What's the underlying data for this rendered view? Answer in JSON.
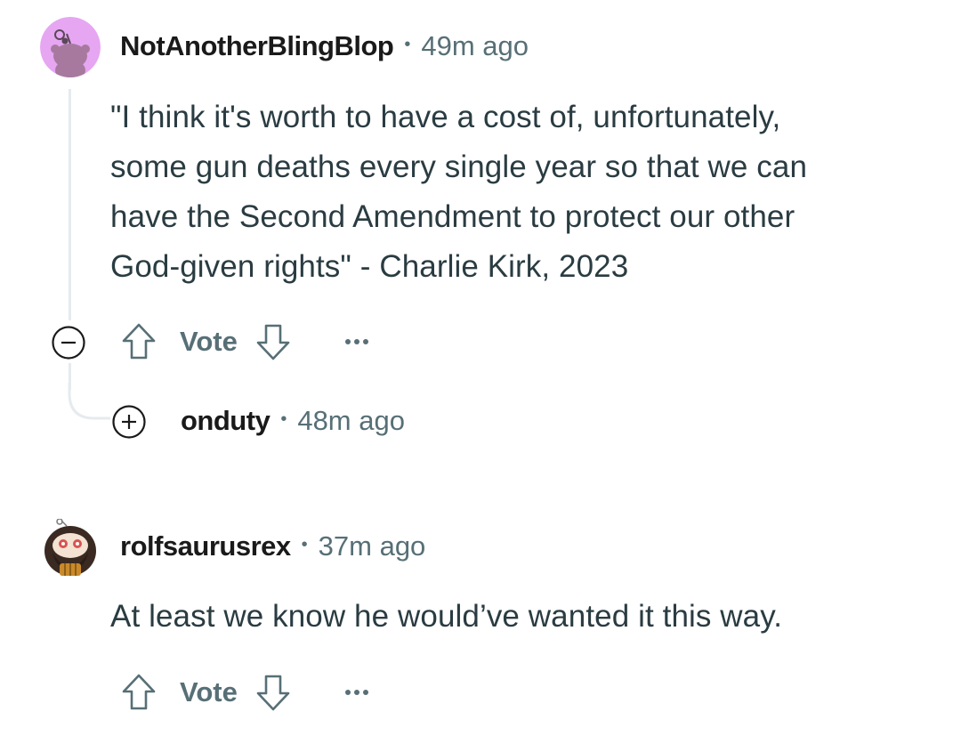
{
  "comments": [
    {
      "username": "NotAnotherBlingBlop",
      "separator": "•",
      "time": "49m ago",
      "lines": [
        "\"I think it's worth to have a cost of, unfortunately,",
        "some gun deaths every single year so that we can",
        "have the Second Amendment to protect our other",
        "God-given rights\" - Charlie Kirk, 2023"
      ],
      "vote_label": "Vote",
      "avatar_color": "#e6a6f2",
      "collapse_icon": "minus-circle-icon"
    },
    {
      "username": "onduty",
      "separator": "•",
      "time": "48m ago",
      "collapsed": true,
      "expand_icon": "plus-circle-icon"
    },
    {
      "username": "rolfsaurusrex",
      "separator": "•",
      "time": "37m ago",
      "lines": [
        "At least we know he would’ve wanted it this way."
      ],
      "vote_label": "Vote"
    }
  ],
  "colors": {
    "meta_gray": "#576f76",
    "text": "#2a3c42",
    "thread_line": "#e5ebee"
  }
}
